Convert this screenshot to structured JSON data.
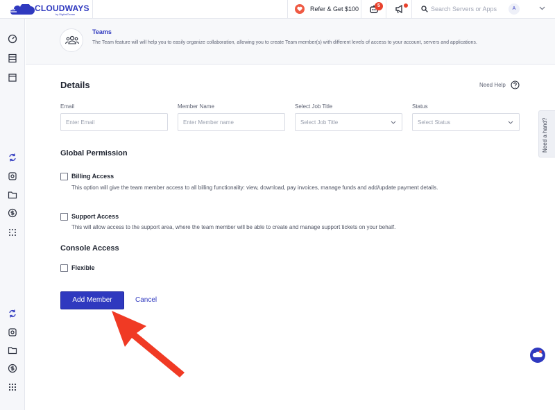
{
  "topbar": {
    "logo_text": "CLOUDWAYS",
    "logo_sub": "by DigitalOcean",
    "refer_label": "Refer & Get $100",
    "notification_count": "5",
    "search_placeholder": "Search Servers or Apps",
    "avatar_letter": "A"
  },
  "banner": {
    "title": "Teams",
    "description": "The Team feature will will help you to easily organize collaboration, allowing you to create Team member(s) with different levels of access to your account, servers and applications."
  },
  "details": {
    "heading": "Details",
    "need_help": "Need Help",
    "email_label": "Email",
    "email_placeholder": "Enter Email",
    "name_label": "Member Name",
    "name_placeholder": "Enter Member name",
    "job_label": "Select Job Title",
    "job_value": "Select Job Title",
    "status_label": "Status",
    "status_value": "Select Status"
  },
  "global_permission": {
    "heading": "Global Permission",
    "billing_label": "Billing Access",
    "billing_desc": "This option will give the team member access to all billing functionality: view, download, pay invoices, manage funds and add/update payment details.",
    "support_label": "Support Access",
    "support_desc": "This will allow access to the support area, where the team member will be able to create and manage support tickets on your behalf."
  },
  "console_access": {
    "heading": "Console Access",
    "flexible_label": "Flexible"
  },
  "actions": {
    "add_label": "Add Member",
    "cancel_label": "Cancel"
  },
  "side_tab": {
    "label": "Need a hand?"
  },
  "colors": {
    "brand": "#2f39bf",
    "annotation_arrow": "#f03a24",
    "badge": "#e8412c"
  },
  "icons": [
    "speedometer-icon",
    "server-icon",
    "app-window-icon",
    "refresh-icon",
    "gear-icon",
    "folder-icon",
    "dollar-icon",
    "grid-icon",
    "heart-icon",
    "bot-icon",
    "megaphone-icon",
    "search-icon",
    "chevron-down-icon",
    "help-circle-icon",
    "team-icon",
    "chat-icon",
    "red-arrow-annotation"
  ]
}
